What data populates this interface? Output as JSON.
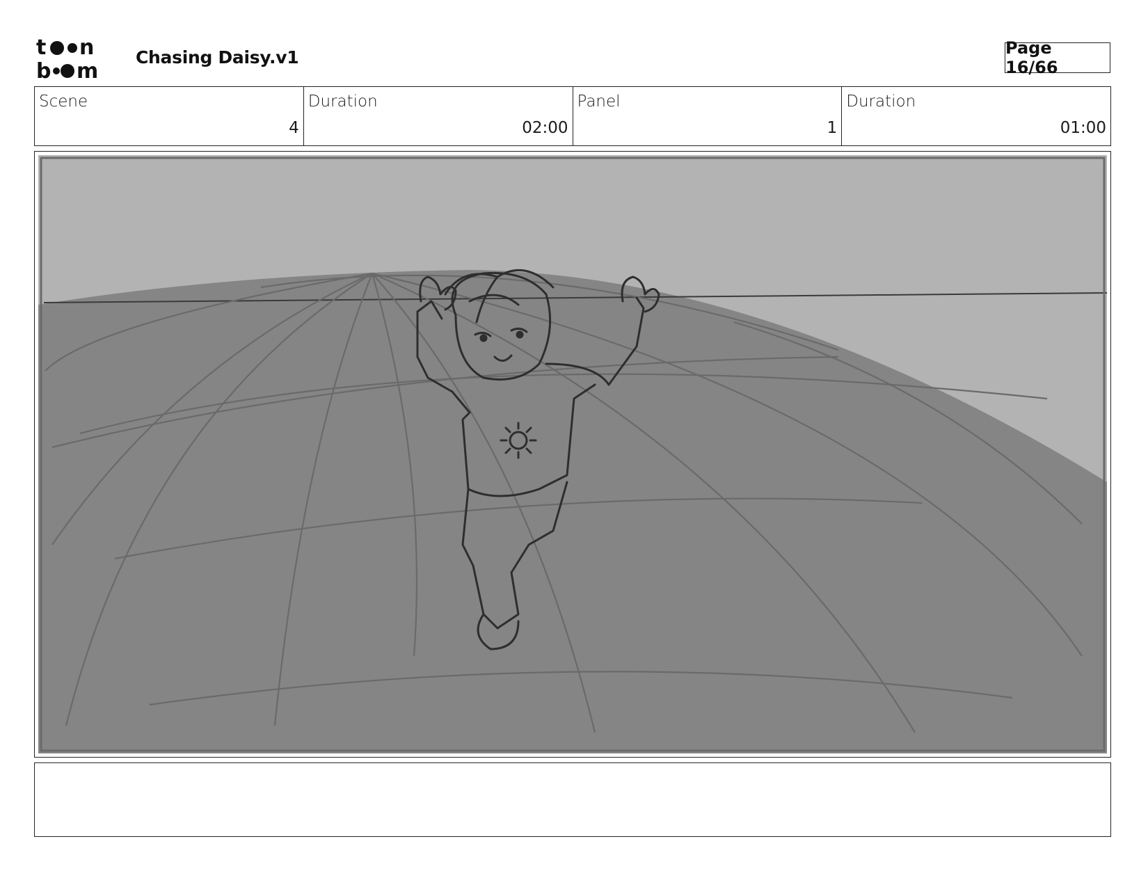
{
  "header": {
    "logo_text": "toon boom",
    "project_title": "Chasing Daisy.v1",
    "page_label": "Page 16/66"
  },
  "info": {
    "scene_label": "Scene",
    "scene_value": "4",
    "scene_duration_label": "Duration",
    "scene_duration_value": "02:00",
    "panel_label": "Panel",
    "panel_value": "1",
    "panel_duration_label": "Duration",
    "panel_duration_value": "01:00"
  },
  "panel": {
    "sky_color": "#b3b3b3",
    "ground_color": "#858585",
    "frame_color": "#6b6b6b",
    "sketch_color": "#2e2e2e"
  },
  "notes": {
    "text": ""
  }
}
